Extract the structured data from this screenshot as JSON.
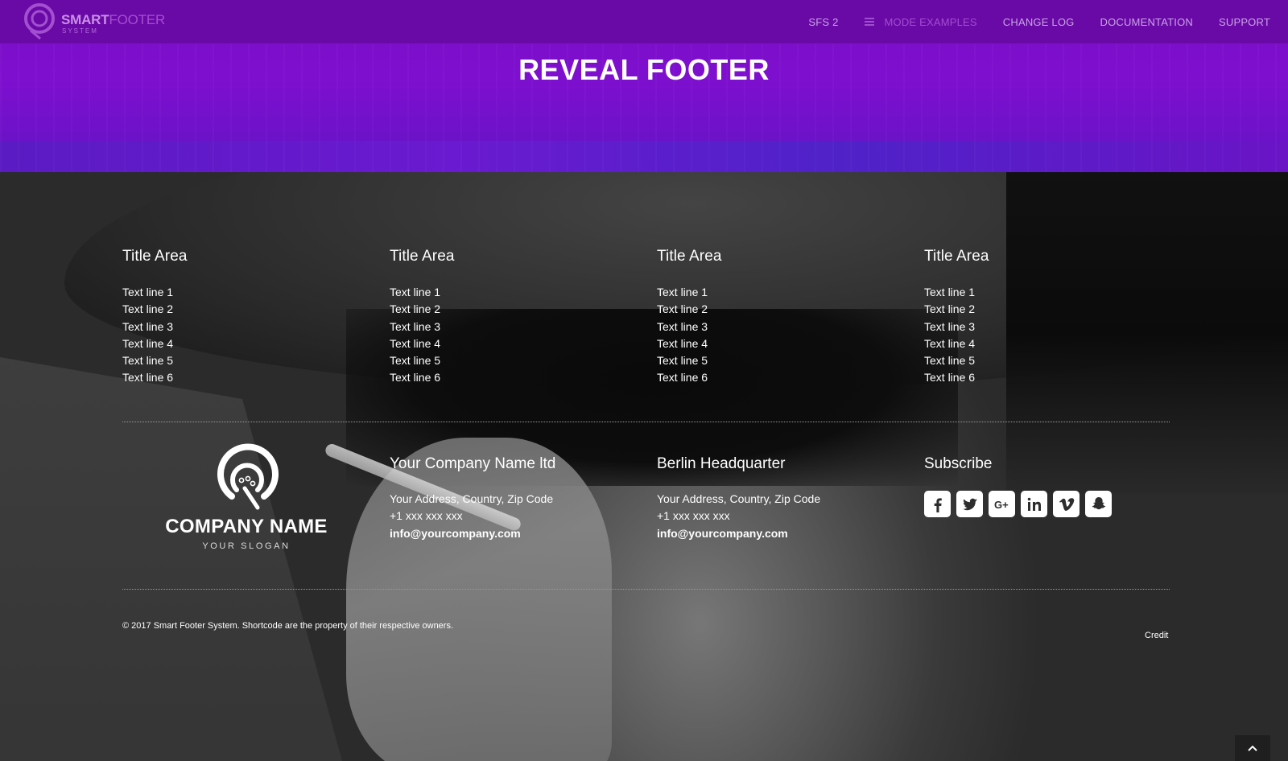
{
  "header": {
    "logo_primary": "SMART",
    "logo_secondary": "FOOTER",
    "logo_sub": "SYSTEM",
    "nav": [
      {
        "label": "SFS 2"
      },
      {
        "label": "MODE EXAMPLES",
        "active": true
      },
      {
        "label": "CHANGE LOG"
      },
      {
        "label": "DOCUMENTATION"
      },
      {
        "label": "SUPPORT"
      }
    ],
    "colors": {
      "nav_bg": "#6a0aa6",
      "hero": "#7e0fcf",
      "active": "#a04ecf"
    }
  },
  "page": {
    "title": "REVEAL FOOTER"
  },
  "footer": {
    "columns": [
      {
        "title": "Title Area",
        "lines": [
          "Text line 1",
          "Text line 2",
          "Text line 3",
          "Text line 4",
          "Text line 5",
          "Text line 6"
        ]
      },
      {
        "title": "Title Area",
        "lines": [
          "Text line 1",
          "Text line 2",
          "Text line 3",
          "Text line 4",
          "Text line 5",
          "Text line 6"
        ]
      },
      {
        "title": "Title Area",
        "lines": [
          "Text line 1",
          "Text line 2",
          "Text line 3",
          "Text line 4",
          "Text line 5",
          "Text line 6"
        ]
      },
      {
        "title": "Title Area",
        "lines": [
          "Text line 1",
          "Text line 2",
          "Text line 3",
          "Text line 4",
          "Text line 5",
          "Text line 6"
        ]
      }
    ],
    "company": {
      "name": "COMPANY NAME",
      "slogan": "YOUR SLOGAN"
    },
    "company_info": {
      "title": "Your Company Name ltd",
      "address": "Your Address, Country, Zip Code",
      "phone": "+1 xxx xxx xxx",
      "email": "info@yourcompany.com"
    },
    "headquarter": {
      "title": "Berlin Headquarter",
      "address": "Your Address, Country, Zip Code",
      "phone": "+1 xxx xxx xxx",
      "email": "info@yourcompany.com"
    },
    "subscribe": {
      "title": "Subscribe",
      "socials": [
        "facebook-icon",
        "twitter-icon",
        "google-plus-icon",
        "linkedin-icon",
        "vimeo-icon",
        "snapchat-icon"
      ]
    },
    "copyright": "© 2017 Smart Footer System. Shortcode are the property of their respective owners.",
    "credit": "Credit"
  }
}
